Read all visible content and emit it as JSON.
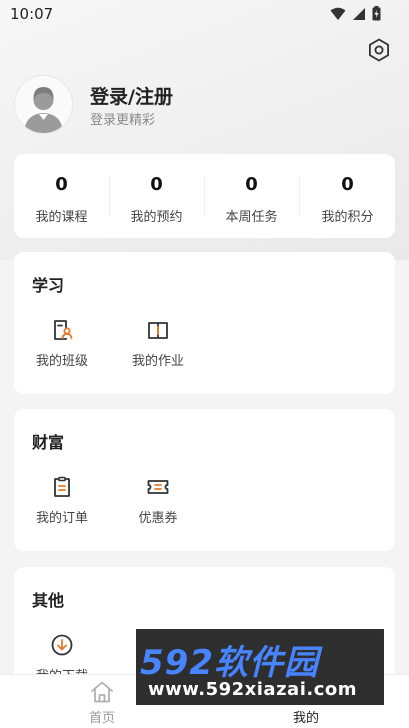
{
  "status_bar": {
    "time": "10:07"
  },
  "profile": {
    "title": "登录/注册",
    "subtitle": "登录更精彩"
  },
  "stats": [
    {
      "value": "0",
      "label": "我的课程"
    },
    {
      "value": "0",
      "label": "我的预约"
    },
    {
      "value": "0",
      "label": "本周任务"
    },
    {
      "value": "0",
      "label": "我的积分"
    }
  ],
  "study": {
    "title": "学习",
    "items": [
      {
        "label": "我的班级",
        "icon": "class-icon"
      },
      {
        "label": "我的作业",
        "icon": "homework-icon"
      }
    ]
  },
  "wealth": {
    "title": "财富",
    "items": [
      {
        "label": "我的订单",
        "icon": "order-icon"
      },
      {
        "label": "优惠券",
        "icon": "coupon-icon"
      }
    ]
  },
  "other": {
    "title": "其他",
    "items": [
      {
        "label": "我的下载",
        "icon": "download-icon"
      }
    ]
  },
  "tabbar": {
    "home": "首页",
    "mine": "我的"
  },
  "watermark": {
    "brand": "592软件园",
    "url": "www.592xiazai.com"
  },
  "colors": {
    "accent": "#e8792b",
    "background": "#f4f4f4",
    "card": "#ffffff"
  }
}
